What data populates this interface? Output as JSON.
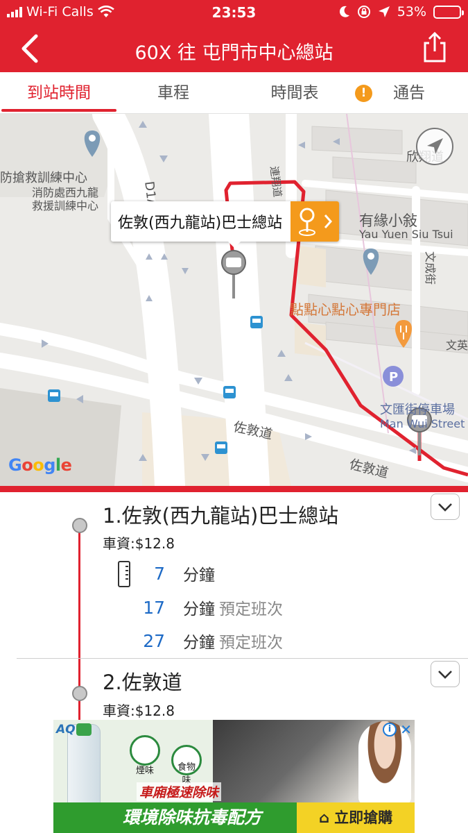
{
  "status_bar": {
    "carrier": "Wi-Fi Calls",
    "time": "23:53",
    "battery": "53%",
    "battery_level": 0.53,
    "battery_color": "#ffd12b"
  },
  "header": {
    "title": "60X 往 屯門市中心總站",
    "back_icon": "chevron-left-icon",
    "share_icon": "share-icon",
    "bg_color": "#e0222f"
  },
  "tabs": [
    {
      "label": "到站時間",
      "active": true
    },
    {
      "label": "車程",
      "active": false
    },
    {
      "label": "時間表",
      "active": false
    },
    {
      "label": "通告",
      "active": false,
      "icon": "!"
    }
  ],
  "map": {
    "callout": "佐敦(西九龍站)巴士總站",
    "labels": {
      "rescue_1": "防搶救訓練中心",
      "rescue_2": "消防處西九龍",
      "rescue_3": "救援訓練中心",
      "road_d1a": "D1A(",
      "road_vertical": "連翔道",
      "yau_yuen_zh": "有緣小敍",
      "yau_yuen_en": "Yau Yuen Siu Tsui",
      "man_shing_street": "文成街",
      "dim_sum": "點點心點心專門店",
      "man_wui_zh": "文匯街停車場",
      "man_wui_en": "Man Wui Street C",
      "jordan_road_1": "佐敦道",
      "jordan_road_2": "佐敦道",
      "man_ying": "文英",
      "top_right": "欣翔道"
    },
    "google_logo": {
      "letters": [
        "G",
        "o",
        "o",
        "g",
        "l",
        "e"
      ],
      "colors": [
        "#4285f4",
        "#ea4335",
        "#fbbc05",
        "#4285f4",
        "#34a853",
        "#ea4335"
      ]
    }
  },
  "stops": [
    {
      "name": "1.佐敦(西九龍站)巴士總站",
      "fare": "車資:$12.8",
      "etas": [
        {
          "minutes": "7",
          "unit": "分鐘",
          "note": ""
        },
        {
          "minutes": "17",
          "unit": "分鐘",
          "note": "預定班次"
        },
        {
          "minutes": "27",
          "unit": "分鐘",
          "note": "預定班次"
        }
      ]
    },
    {
      "name": "2.佐敦道",
      "fare": "車資:$12.8"
    }
  ],
  "ad": {
    "brand": "AQ",
    "badge_1": "煙味",
    "badge_2": "食物味",
    "headline": "車廂極速除味",
    "main": "環境除味抗毒配方",
    "cta": "立即搶購"
  }
}
